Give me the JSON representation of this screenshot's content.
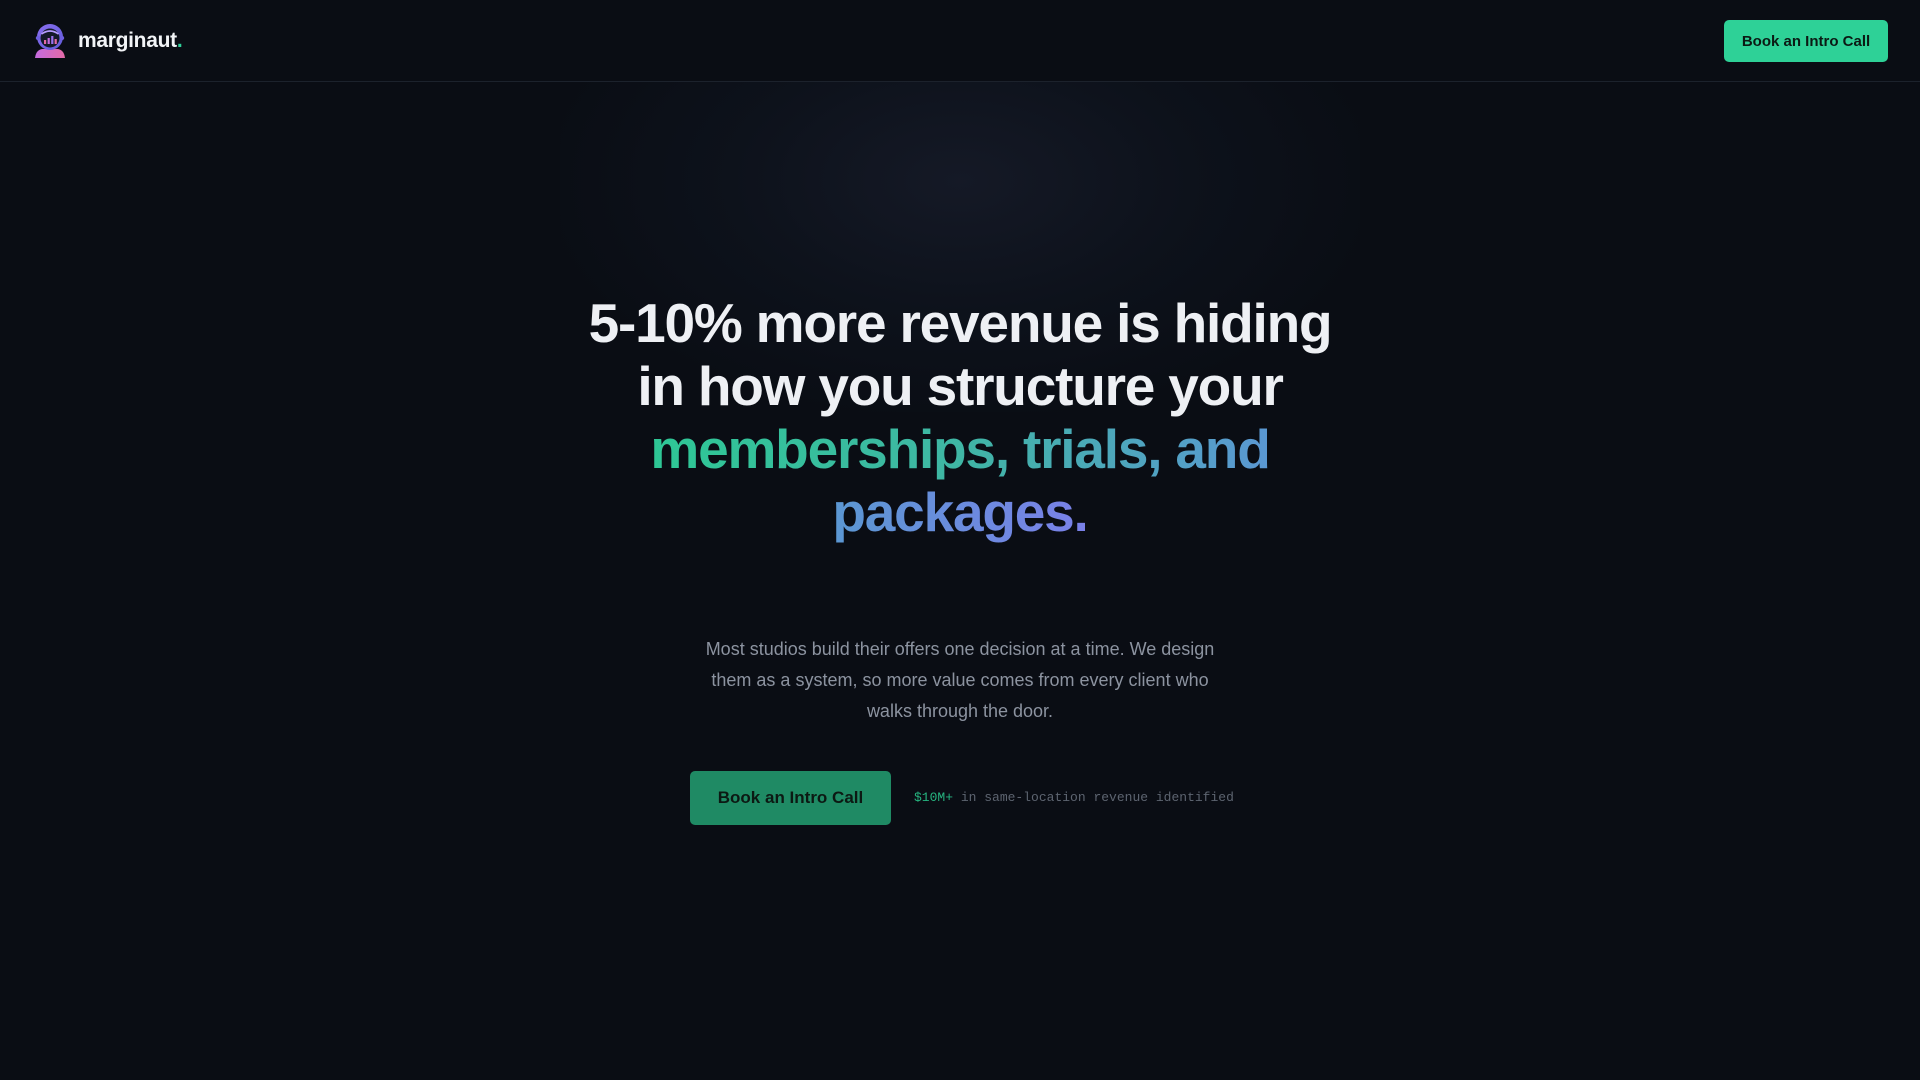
{
  "header": {
    "brand_name": "marginaut",
    "brand_dot": ".",
    "cta_label": "Book an Intro Call"
  },
  "hero": {
    "title_plain": "5-10% more revenue is hiding in how you structure your",
    "title_accent": "memberships, trials, and packages.",
    "subtitle": "Most studios build their offers one decision at a time. We design them as a system, so more value comes from every client who walks through the door.",
    "cta_label": "Book an Intro Call",
    "stat_value": "$10M+",
    "stat_text": "in same-location revenue identified"
  },
  "colors": {
    "background": "#0a0d14",
    "accent_green": "#2ed197",
    "accent_blue": "#5a98d2",
    "accent_purple": "#7a80e8"
  },
  "icons": {
    "logo": "astronaut-helmet-chart-icon"
  }
}
